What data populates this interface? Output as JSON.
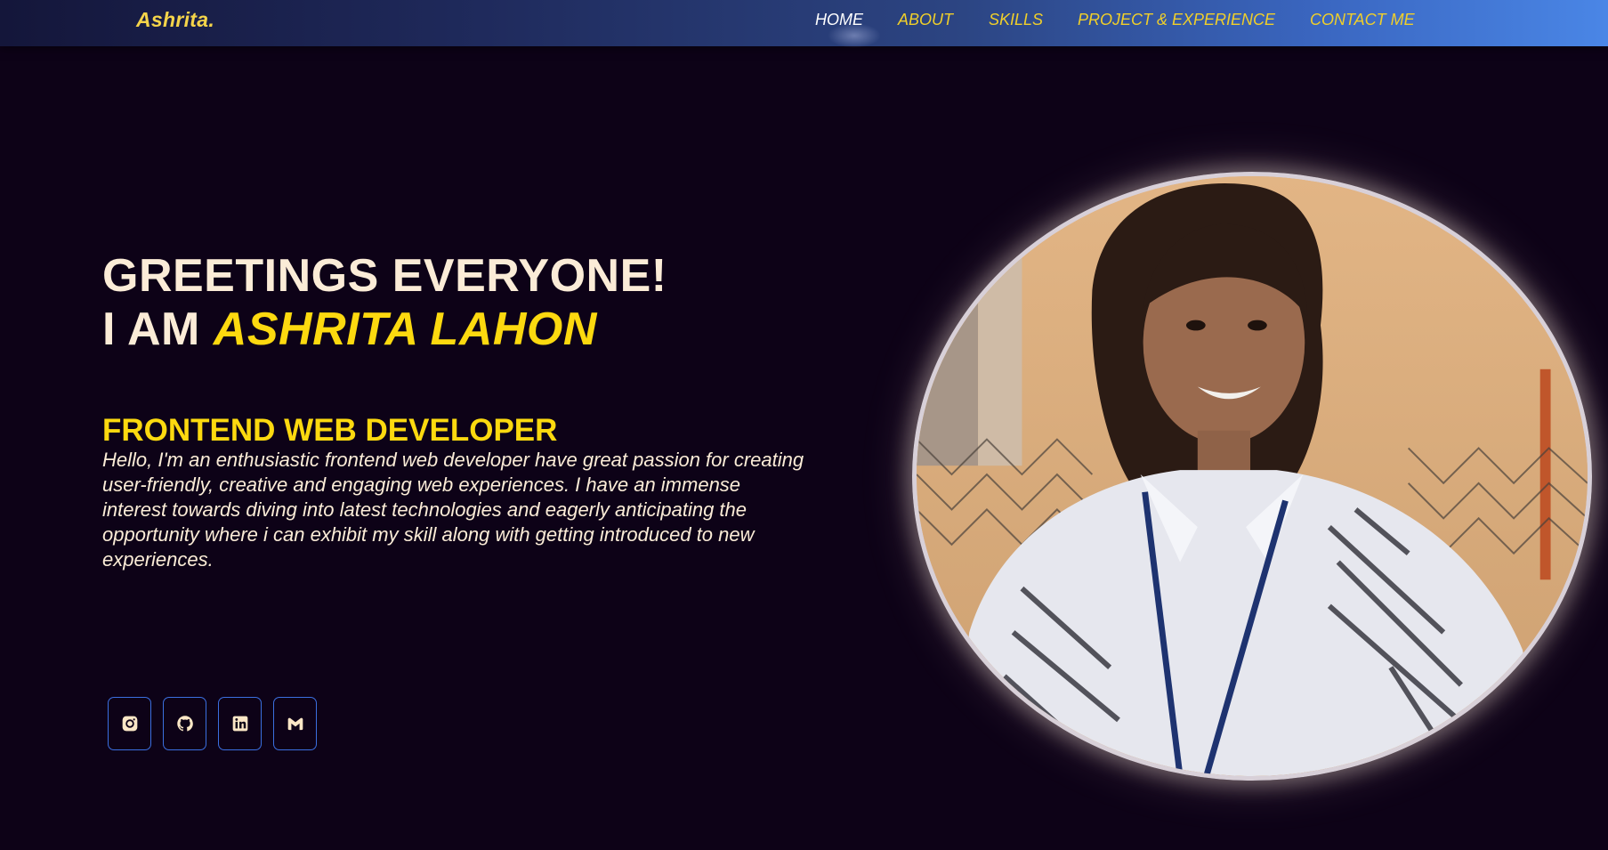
{
  "nav": {
    "brand": "Ashrita.",
    "links": [
      {
        "label": "HOME",
        "active": true
      },
      {
        "label": "ABOUT",
        "active": false
      },
      {
        "label": "SKILLS",
        "active": false
      },
      {
        "label": "PROJECT & EXPERIENCE",
        "active": false
      },
      {
        "label": "CONTACT ME",
        "active": false
      }
    ]
  },
  "hero": {
    "greeting": "GREETINGS EVERYONE!",
    "name_prefix": "I AM",
    "name": "ASHRITA LAHON",
    "role": "FRONTEND WEB DEVELOPER",
    "intro": "Hello, I'm an enthusiastic frontend web developer have great passion for creating user-friendly, creative and engaging web experiences. I have an immense interest towards diving into latest technologies and eagerly anticipating the opportunity where i can exhibit my skill along with getting introduced to new experiences."
  },
  "socials": [
    {
      "icon": "instagram-icon"
    },
    {
      "icon": "github-icon"
    },
    {
      "icon": "linkedin-icon"
    },
    {
      "icon": "gmail-icon"
    }
  ],
  "colors": {
    "background": "#0d0217",
    "accent_yellow": "#fcd90f",
    "text_cream": "#fbecd7",
    "button_border": "#3b6fe0",
    "nav_gradient_end": "#4a86e6"
  }
}
